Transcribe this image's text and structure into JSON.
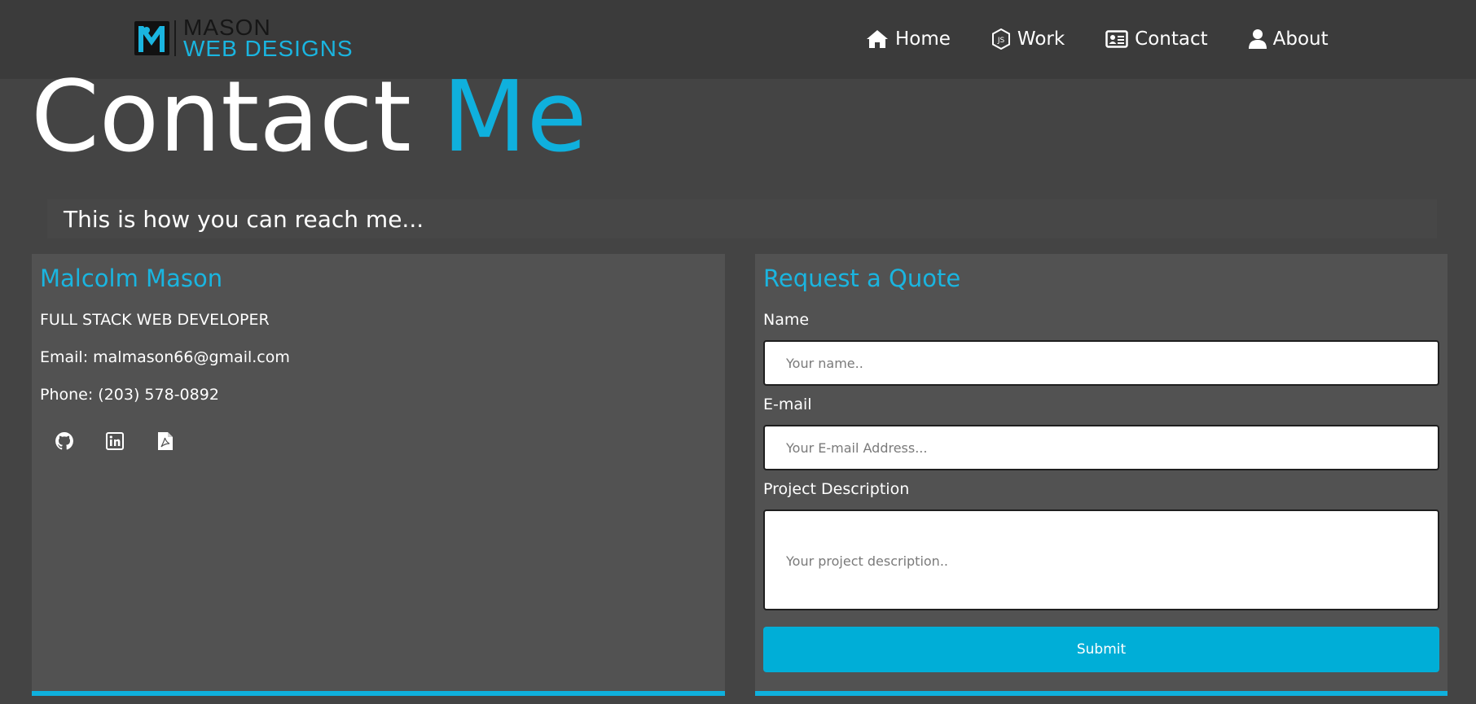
{
  "brand": {
    "line1": "MASON",
    "line2": "WEB DESIGNS",
    "accent_color": "#0fb0dd"
  },
  "nav": {
    "items": [
      {
        "label": "Home",
        "icon": "home-icon"
      },
      {
        "label": "Work",
        "icon": "nodejs-icon"
      },
      {
        "label": "Contact",
        "icon": "id-card-icon"
      },
      {
        "label": "About",
        "icon": "user-icon"
      }
    ]
  },
  "page": {
    "title_main": "Contact ",
    "title_accent": "Me",
    "subtitle": "This is how you can reach me..."
  },
  "profile": {
    "name": "Malcolm Mason",
    "role": "FULL STACK WEB DEVELOPER",
    "email": "Email: malmason66@gmail.com",
    "phone": "Phone: (203) 578-0892",
    "social": [
      "github-icon",
      "linkedin-icon",
      "pdf-resume-icon"
    ]
  },
  "quote_form": {
    "title": "Request a Quote",
    "name_label": "Name",
    "name_placeholder": "Your name..",
    "email_label": "E-mail",
    "email_placeholder": "Your E-mail Address...",
    "description_label": "Project Description",
    "description_placeholder": "Your project description..",
    "submit_label": "Submit"
  }
}
